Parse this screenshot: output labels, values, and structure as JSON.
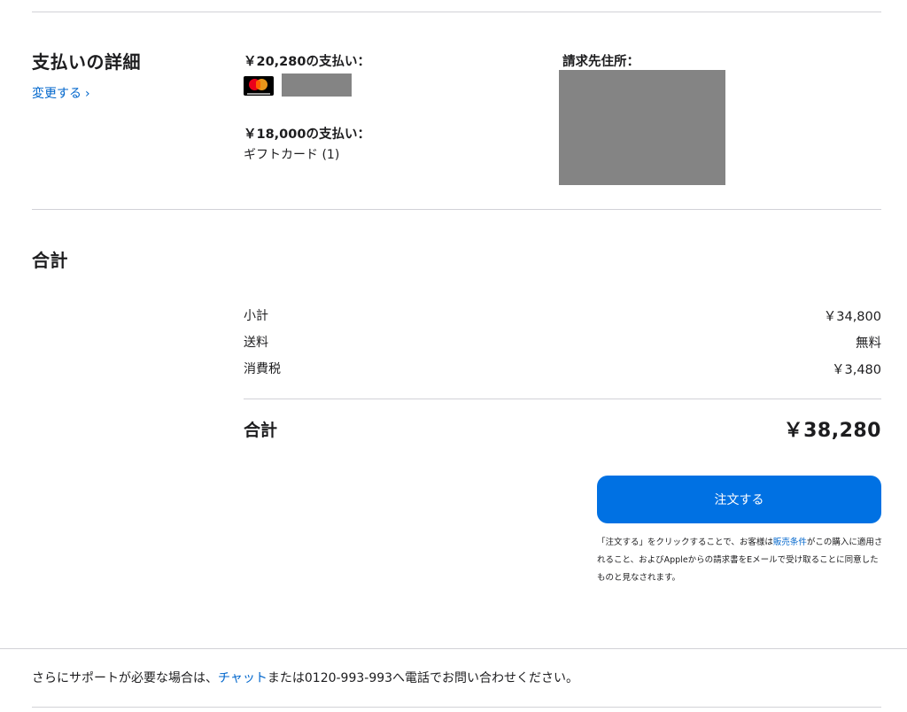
{
  "payment": {
    "title": "支払いの詳細",
    "change_label": "変更する",
    "card_amount_label": "￥20,280の支払い：",
    "gift_amount_label": "￥18,000の支払い：",
    "gift_card_text": "ギフトカード (1)",
    "billing_label": "請求先住所：",
    "card_brand_icon": "mastercard-icon"
  },
  "summary": {
    "title": "合計",
    "rows": [
      {
        "label": "小計",
        "value": "￥34,800"
      },
      {
        "label": "送料",
        "value": "無料"
      },
      {
        "label": "消費税",
        "value": "￥3,480"
      }
    ],
    "total_label": "合計",
    "total_value": "￥38,280"
  },
  "order": {
    "button_label": "注文する",
    "legal_prefix": "「注文する」をクリックすることで、お客様は",
    "legal_link": "販売条件",
    "legal_suffix": "がこの購入に適用されること、およびAppleからの請求書をEメールで受け取ることに同意したものと見なされます。"
  },
  "footer": {
    "prefix": "さらにサポートが必要な場合は、",
    "chat_link": "チャット",
    "suffix": "または0120-993-993へ電話でお問い合わせください。"
  },
  "colors": {
    "accent": "#0071e3",
    "link": "#0066cc",
    "redaction": "#848484"
  }
}
